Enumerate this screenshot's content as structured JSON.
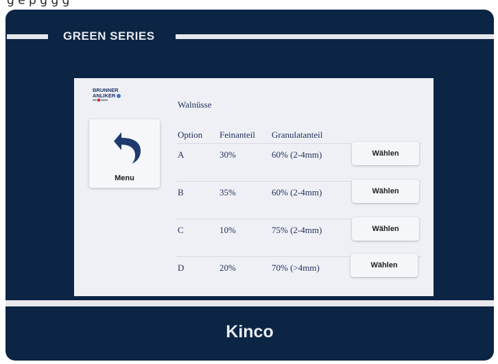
{
  "top_strip_text": "g e    p g   g g",
  "device": {
    "series_label": "GREEN  SERIES",
    "brand": "Kinco"
  },
  "logo": {
    "line1": "BRUNNER",
    "line2": "ANLIKER",
    "tagline": "swiss made"
  },
  "menu_button": {
    "label": "Menu",
    "icon": "back-arrow-icon"
  },
  "screen_title": "Walnüsse",
  "table": {
    "headers": [
      "Option",
      "Feinanteil",
      "Granulatanteil"
    ],
    "rows": [
      {
        "option": "A",
        "fein": "30%",
        "granulat": "60% (2-4mm)",
        "button": "Wählen"
      },
      {
        "option": "B",
        "fein": "35%",
        "granulat": "60% (2-4mm)",
        "button": "Wählen"
      },
      {
        "option": "C",
        "fein": "10%",
        "granulat": "75% (2-4mm)",
        "button": "Wählen"
      },
      {
        "option": "D",
        "fein": "20%",
        "granulat": "70% (>4mm)",
        "button": "Wählen"
      }
    ]
  },
  "colors": {
    "bezel": "#0c2545",
    "screen_bg": "#eef0f5",
    "text": "#23315a",
    "accent_blue": "#3a78c8",
    "logo_red": "#d42a2a"
  }
}
